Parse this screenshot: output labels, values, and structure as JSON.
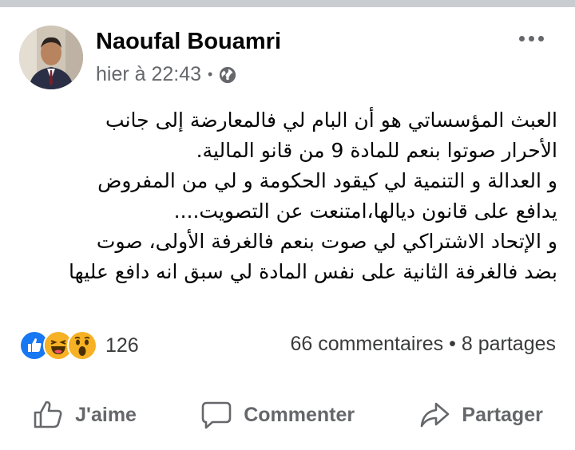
{
  "post": {
    "author": "Naoufal Bouamri",
    "timestamp": "hier à 22:43",
    "visibility_icon": "globe-icon",
    "menu_icon": "more-options-icon",
    "text_lines": [
      "العبث المؤسساتي هو أن البام لي فالمعارضة إلى جانب",
      "الأحرار صوتوا  بنعم للمادة 9 من قانو المالية.",
      "و العدالة و التنمية لي كيقود الحكومة و لي من المفروض",
      "يدافع على قانون ديالها،امتنعت عن التصويت....",
      "و الإتحاد الاشتراكي لي صوت بنعم فالغرفة الأولى، صوت",
      "بضد فالغرفة الثانية على نفس المادة لي سبق انه دافع عليها"
    ]
  },
  "engagement": {
    "reaction_icons": [
      "like-icon",
      "haha-icon",
      "wow-icon"
    ],
    "reaction_count": "126",
    "comments": "66 commentaires",
    "separator": "•",
    "shares": "8 partages"
  },
  "actions": {
    "like": "J'aime",
    "comment": "Commenter",
    "share": "Partager"
  },
  "colors": {
    "like_blue": "#1877f2",
    "emoji_yellow": "#f7b125",
    "secondary_text": "#65676b"
  }
}
